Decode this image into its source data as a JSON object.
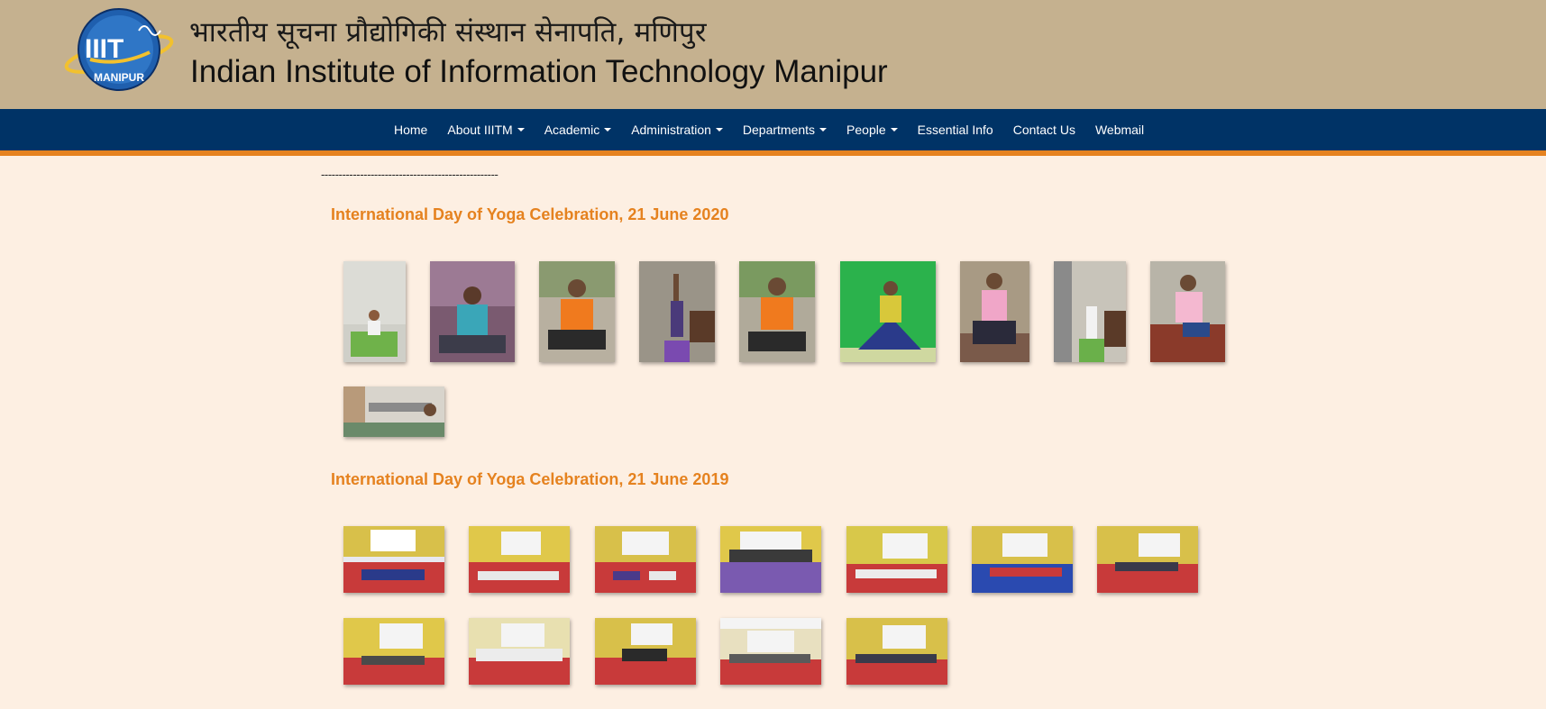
{
  "header": {
    "logo_text_top": "IIIT",
    "logo_text_bottom": "MANIPUR",
    "title_hindi": "भारतीय सूचना प्रौद्योगिकी संस्थान सेनापति, मणिपुर",
    "title_english": "Indian Institute of Information Technology Manipur"
  },
  "nav": {
    "items": [
      {
        "label": "Home",
        "dropdown": false
      },
      {
        "label": "About IIITM",
        "dropdown": true
      },
      {
        "label": "Academic",
        "dropdown": true
      },
      {
        "label": "Administration",
        "dropdown": true
      },
      {
        "label": "Departments",
        "dropdown": true
      },
      {
        "label": "People",
        "dropdown": true
      },
      {
        "label": "Essential Info",
        "dropdown": false
      },
      {
        "label": "Contact Us",
        "dropdown": false
      },
      {
        "label": "Webmail",
        "dropdown": false
      }
    ]
  },
  "main": {
    "divider": "--------------------------------------------------",
    "sections": [
      {
        "title": "International Day of Yoga Celebration, 21 June 2020",
        "photo_count": 10
      },
      {
        "title": "International Day of Yoga Celebration, 21 June 2019",
        "photo_count": 12
      }
    ]
  },
  "colors": {
    "header_bg": "#c5b18f",
    "nav_bg": "#003366",
    "nav_accent": "#e5821f",
    "page_bg": "#fdefe2",
    "section_title": "#e5821f"
  }
}
